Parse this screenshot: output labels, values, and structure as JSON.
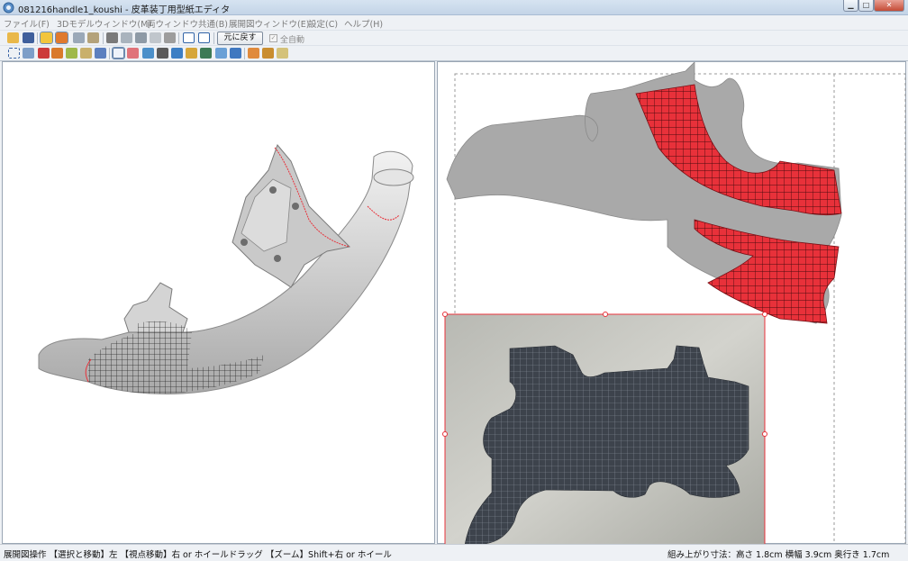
{
  "window": {
    "title": "081216handle1_koushi - 皮革装丁用型紙エディタ",
    "minimize_glyph": "▁",
    "maximize_glyph": "□",
    "close_glyph": "✕"
  },
  "menu": [
    {
      "label": "ファイル(F)"
    },
    {
      "label": "3Dモデルウィンドウ(M)"
    },
    {
      "label": "両ウィンドウ共通(B)"
    },
    {
      "label": "展開図ウィンドウ(E)"
    },
    {
      "label": "設定(C)"
    },
    {
      "label": "ヘルプ(H)"
    }
  ],
  "toolbar": {
    "undo_label": "元に戻す",
    "auto_label": "全自動",
    "auto_checked": true,
    "row1_icons": [
      "open-folder-icon",
      "save-icon",
      "model-view-icon",
      "texture-view-icon",
      "cube-icon",
      "cube-open-icon",
      "pen-icon",
      "cylinder-icon",
      "move-3d-icon",
      "box-select-icon",
      "cut-icon",
      "window-single-icon",
      "window-dual-icon"
    ],
    "row2_icons": [
      "fit-view-icon",
      "grid-icon",
      "paint-icon",
      "clip-icon",
      "measure-icon",
      "frame-icon",
      "image-icon",
      "select-arrow-icon",
      "pointer-move-icon",
      "rotate-icon",
      "hatch-icon",
      "ruler-icon",
      "text-icon",
      "photo-icon",
      "zoom-icon",
      "undo-arrow-icon",
      "color-icon",
      "export-icon",
      "print-icon"
    ]
  },
  "statusbar": {
    "left_text": "展開図操作 【選択と移動】左 【視点移動】右 or ホイールドラッグ 【ズーム】Shift+右 or ホイール",
    "right_text": "組み上がり寸法：高さ 1.8cm 横幅 3.9cm 奥行き 1.7cm"
  },
  "colors": {
    "mesh_red": "#e8313a",
    "model_gray": "#d2d2d2",
    "leather_dark": "#3d434c"
  }
}
